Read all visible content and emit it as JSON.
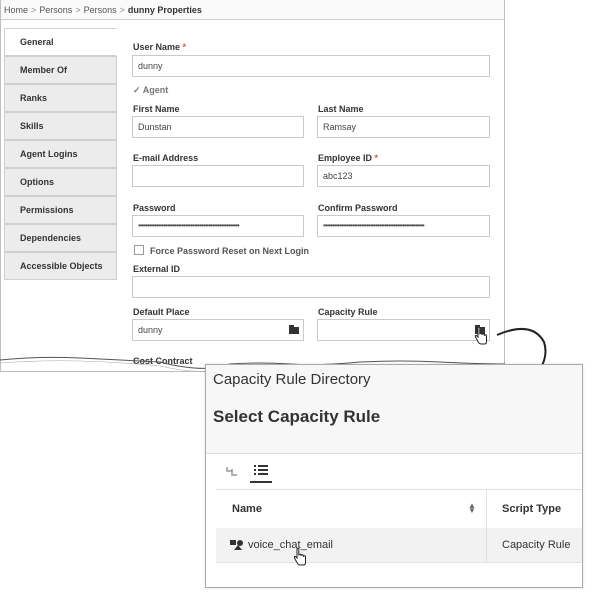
{
  "breadcrumb": {
    "items": [
      "Home",
      "Persons",
      "Persons"
    ],
    "separator": ">",
    "current": "dunny Properties"
  },
  "tabs": [
    {
      "label": "General",
      "active": true
    },
    {
      "label": "Member Of"
    },
    {
      "label": "Ranks"
    },
    {
      "label": "Skills"
    },
    {
      "label": "Agent Logins"
    },
    {
      "label": "Options"
    },
    {
      "label": "Permissions"
    },
    {
      "label": "Dependencies"
    },
    {
      "label": "Accessible Objects"
    }
  ],
  "form": {
    "user_name": {
      "label": "User Name",
      "required_mark": "*",
      "value": "dunny"
    },
    "agent": {
      "label": "Agent",
      "checked": true,
      "check_glyph": "✓"
    },
    "first_name": {
      "label": "First Name",
      "value": "Dunstan"
    },
    "last_name": {
      "label": "Last Name",
      "value": "Ramsay"
    },
    "email": {
      "label": "E-mail Address",
      "value": ""
    },
    "employee_id": {
      "label": "Employee ID",
      "required_mark": "*",
      "value": "abc123"
    },
    "password": {
      "label": "Password",
      "value": "••••••••••••••••••••••••••••••••••••••••••••••••••••••••"
    },
    "confirm_password": {
      "label": "Confirm Password",
      "value": "••••••••••••••••••••••••••••••••••••••••••••••••••••••••"
    },
    "force_reset": {
      "label": "Force Password Reset on Next Login",
      "checked": false
    },
    "external_id": {
      "label": "External ID",
      "value": ""
    },
    "default_place": {
      "label": "Default Place",
      "value": "dunny",
      "icon": "folder-icon"
    },
    "capacity_rule": {
      "label": "Capacity Rule",
      "value": "",
      "icon": "folder-icon"
    },
    "cost_contract": {
      "label": "Cost Contract"
    }
  },
  "directory": {
    "title": "Capacity Rule Directory",
    "heading": "Select Capacity Rule",
    "view_icons": [
      "hierarchy-icon",
      "list-icon"
    ],
    "columns": [
      "Name",
      "Script Type"
    ],
    "rows": [
      {
        "name": "voice_chat_email",
        "script_type": "Capacity Rule",
        "icon": "capacity-rule-icon"
      }
    ]
  },
  "colors": {
    "required": "#d9534f",
    "tab_bg": "#ececec",
    "border": "#c9c9c9",
    "row_highlight": "#f2f2f2"
  }
}
